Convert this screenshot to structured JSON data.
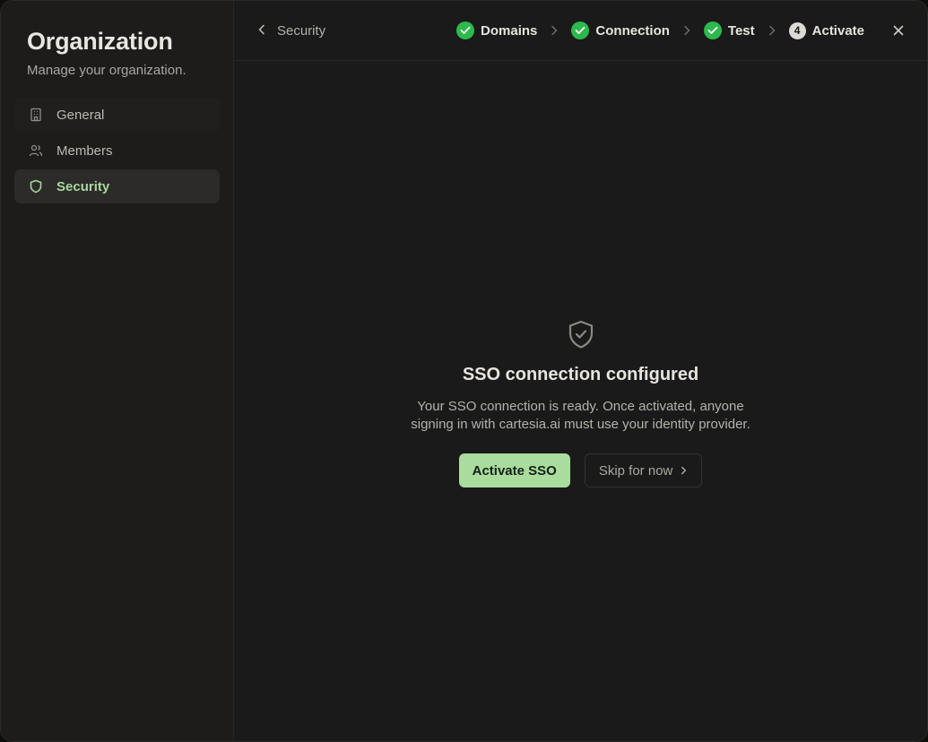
{
  "sidebar": {
    "title": "Organization",
    "subtitle": "Manage your organization.",
    "items": [
      {
        "label": "General",
        "icon": "building-icon",
        "state": "hover"
      },
      {
        "label": "Members",
        "icon": "users-icon",
        "state": "normal"
      },
      {
        "label": "Security",
        "icon": "shield-icon",
        "state": "active"
      }
    ]
  },
  "header": {
    "back_label": "Security",
    "steps": [
      {
        "label": "Domains",
        "status": "complete"
      },
      {
        "label": "Connection",
        "status": "complete"
      },
      {
        "label": "Test",
        "status": "complete"
      },
      {
        "label": "Activate",
        "status": "current",
        "number": "4"
      }
    ]
  },
  "main": {
    "heading": "SSO connection configured",
    "description_line1": "Your SSO connection is ready. Once activated, anyone",
    "description_line2": "signing in with cartesia.ai must use your identity provider.",
    "primary_button": "Activate SSO",
    "secondary_button": "Skip for now"
  },
  "colors": {
    "accent_green": "#a9dc9d",
    "step_complete": "#2db94d",
    "background": "#1a1a1a",
    "sidebar_background": "#1d1c1a"
  }
}
